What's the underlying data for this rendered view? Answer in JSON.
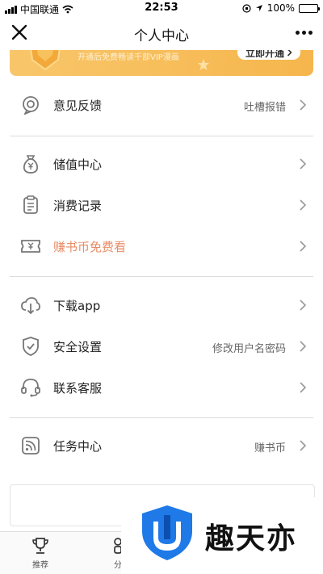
{
  "status_bar": {
    "carrier": "中国联通",
    "time": "22:53",
    "battery": "100%",
    "battery_level": 1.0
  },
  "nav": {
    "title": "个人中心"
  },
  "vip_banner": {
    "text": "开通后免费畅读千部VIP漫画",
    "button_label": "立即开通"
  },
  "menu": {
    "feedback": {
      "label": "意见反馈",
      "hint": "吐槽报错",
      "icon": "feedback-icon"
    },
    "recharge": {
      "label": "储值中心",
      "icon": "money-bag-icon"
    },
    "records": {
      "label": "消费记录",
      "icon": "receipt-icon"
    },
    "earn": {
      "label": "赚书币免费看",
      "icon": "ticket-icon"
    },
    "download": {
      "label": "下载app",
      "icon": "cloud-download-icon"
    },
    "security": {
      "label": "安全设置",
      "hint": "修改用户名密码",
      "icon": "shield-check-icon"
    },
    "support": {
      "label": "联系客服",
      "icon": "headset-icon"
    },
    "tasks": {
      "label": "任务中心",
      "hint": "赚书币",
      "icon": "rss-icon"
    }
  },
  "tabs": [
    {
      "label": "推荐",
      "icon": "trophy-icon"
    },
    {
      "label": "分",
      "icon": "category-icon"
    }
  ],
  "watermark": {
    "text": "趣天亦"
  },
  "colors": {
    "accent": "#e98b66",
    "vip": "#f6b64d",
    "watermark_blue": "#1f7ae8"
  }
}
